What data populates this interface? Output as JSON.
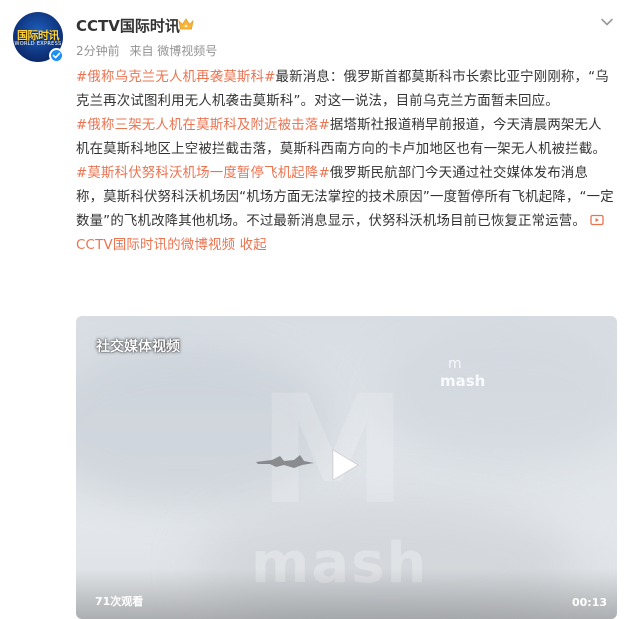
{
  "author": {
    "avatar_text": "国际时讯",
    "avatar_sub": "WORLD EXPRESS",
    "name": "CCTV国际时讯",
    "time": "2分钟前",
    "source": "来自 微博视频号"
  },
  "post": {
    "p1_topic": "#俄称乌克兰无人机再袭莫斯科#",
    "p1_text": "最新消息：俄罗斯首都莫斯科市长索比亚宁刚刚称，“乌克兰再次试图利用无人机袭击莫斯科”。对这一说法，目前乌克兰方面暂未回应。",
    "p2_topic": "#俄称三架无人机在莫斯科及附近被击落#",
    "p2_text": "据塔斯社报道稍早前报道，今天清晨两架无人机在莫斯科地区上空被拦截击落，莫斯科西南方向的卡卢加地区也有一架无人机被拦截。",
    "p3_topic": "#莫斯科伏努科沃机场一度暂停飞机起降#",
    "p3_text": "俄罗斯民航部门今天通过社交媒体发布消息称，莫斯科伏努科沃机场因“机场方面无法掌控的技术原因”一度暂停所有飞机起降，“一定数量”的飞机改降其他机场。不过最新消息显示，伏努科沃机场目前已恢复正常运营。",
    "video_link": "CCTV国际时讯的微博视频",
    "collapse": "收起"
  },
  "video": {
    "label": "社交媒体视频",
    "watermark_small_top": "m",
    "watermark_small": "mash",
    "watermark_big": "mash",
    "watermark_m": "M",
    "views": "71次观看",
    "duration": "00:13"
  },
  "colors": {
    "topic": "#eb7350",
    "verified": "#1f8ef1",
    "meta": "#939393"
  },
  "icons": [
    "verified-icon",
    "crown-icon",
    "chevron-down-icon",
    "video-link-icon",
    "play-icon"
  ]
}
